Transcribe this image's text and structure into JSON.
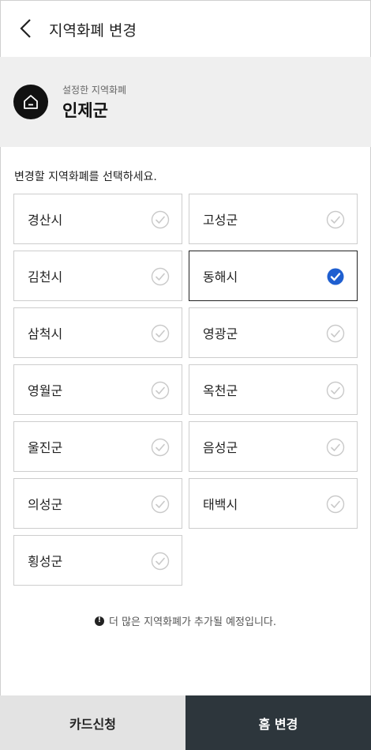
{
  "header": {
    "title": "지역화폐 변경",
    "back_icon": "chevron-left-icon"
  },
  "current": {
    "sub_label": "설정한 지역화폐",
    "name": "인제군",
    "icon": "home-icon"
  },
  "instruction": "변경할 지역화폐를 선택하세요.",
  "options": [
    {
      "label": "경산시",
      "selected": false
    },
    {
      "label": "고성군",
      "selected": false
    },
    {
      "label": "김천시",
      "selected": false
    },
    {
      "label": "동해시",
      "selected": true
    },
    {
      "label": "삼척시",
      "selected": false
    },
    {
      "label": "영광군",
      "selected": false
    },
    {
      "label": "영월군",
      "selected": false
    },
    {
      "label": "옥천군",
      "selected": false
    },
    {
      "label": "울진군",
      "selected": false
    },
    {
      "label": "음성군",
      "selected": false
    },
    {
      "label": "의성군",
      "selected": false
    },
    {
      "label": "태백시",
      "selected": false
    },
    {
      "label": "횡성군",
      "selected": false
    }
  ],
  "notice": "더 많은 지역화폐가 추가될 예정입니다.",
  "footer": {
    "card_apply": "카드신청",
    "change_home": "홈 변경"
  },
  "colors": {
    "selected_check": "#1f5fd0",
    "unselected_check": "#c9c9c9",
    "primary_button": "#2d363c",
    "secondary_button": "#e3e3e3"
  }
}
